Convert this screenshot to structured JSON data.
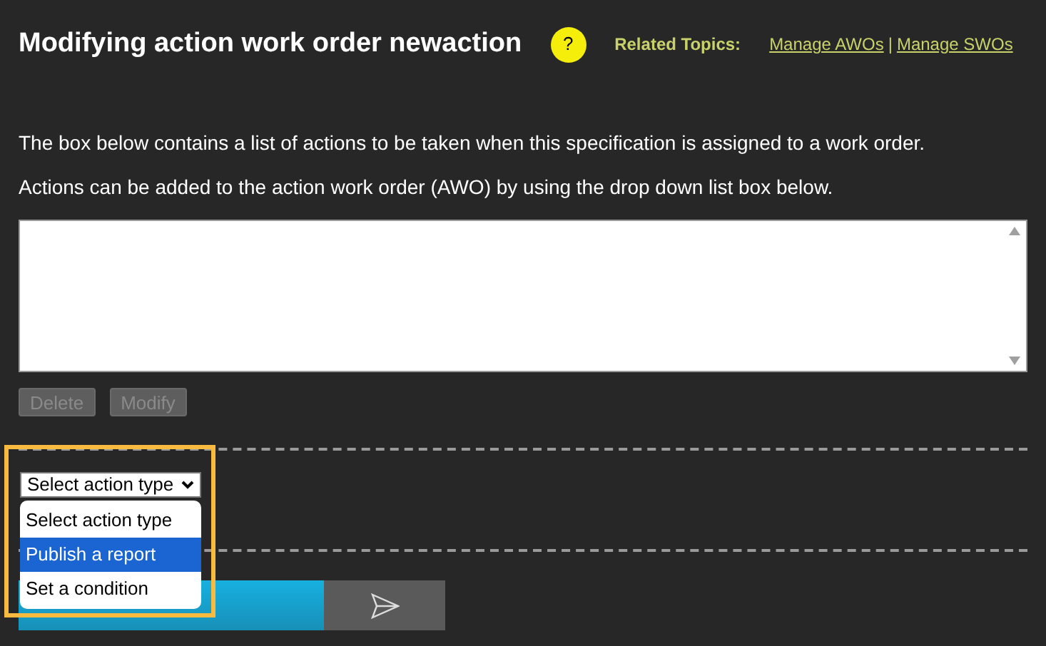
{
  "title": "Modifying action work order newaction",
  "help_icon": "?",
  "related": {
    "label": "Related Topics:",
    "links": [
      "Manage AWOs",
      "Manage SWOs"
    ],
    "separator": "|"
  },
  "paragraphs": [
    "The box below contains a list of actions to be taken when this specification is assigned to a work order.",
    "Actions can be added to the action work order (AWO) by using the drop down list box below."
  ],
  "buttons": [
    {
      "label": "Delete",
      "disabled": true
    },
    {
      "label": "Modify",
      "disabled": true
    }
  ],
  "action_select": {
    "value": "Select action type",
    "options": [
      {
        "label": "Select action type",
        "highlighted": false
      },
      {
        "label": "Publish a report",
        "highlighted": true
      },
      {
        "label": "Set a condition",
        "highlighted": false
      }
    ]
  }
}
